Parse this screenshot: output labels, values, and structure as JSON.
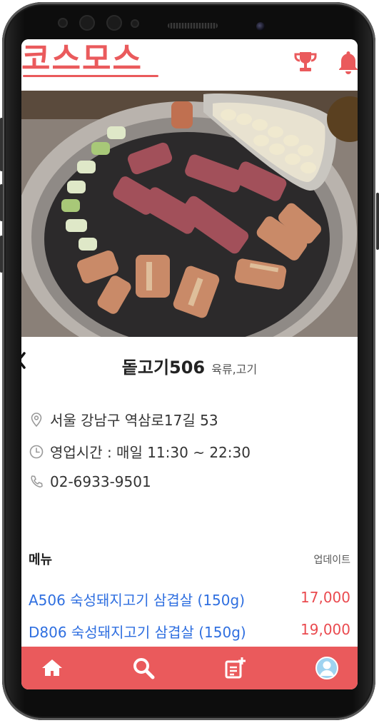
{
  "header": {
    "logo": "코스모스",
    "icons": [
      "trophy-icon",
      "bell-icon"
    ]
  },
  "restaurant": {
    "name": "돝고기506",
    "category": "육류,고기",
    "address": "서울 강남구 역삼로17길 53",
    "hours": "영업시간 : 매일 11:30 ~ 22:30",
    "phone": "02-6933-9501"
  },
  "menu": {
    "title": "메뉴",
    "update_label": "업데이트",
    "items": [
      {
        "name": "A506 숙성돼지고기 삼겹살 (150g)",
        "price": "17,000"
      },
      {
        "name": "D806 숙성돼지고기 삼겹살 (150g)",
        "price": "19,000"
      }
    ]
  },
  "tabbar": {
    "items": [
      "home-icon",
      "search-icon",
      "post-add-icon",
      "profile-icon"
    ]
  },
  "colors": {
    "brand": "#ea5a5c",
    "menu_name": "#2f6fe0",
    "menu_price": "#ea4a4f"
  }
}
